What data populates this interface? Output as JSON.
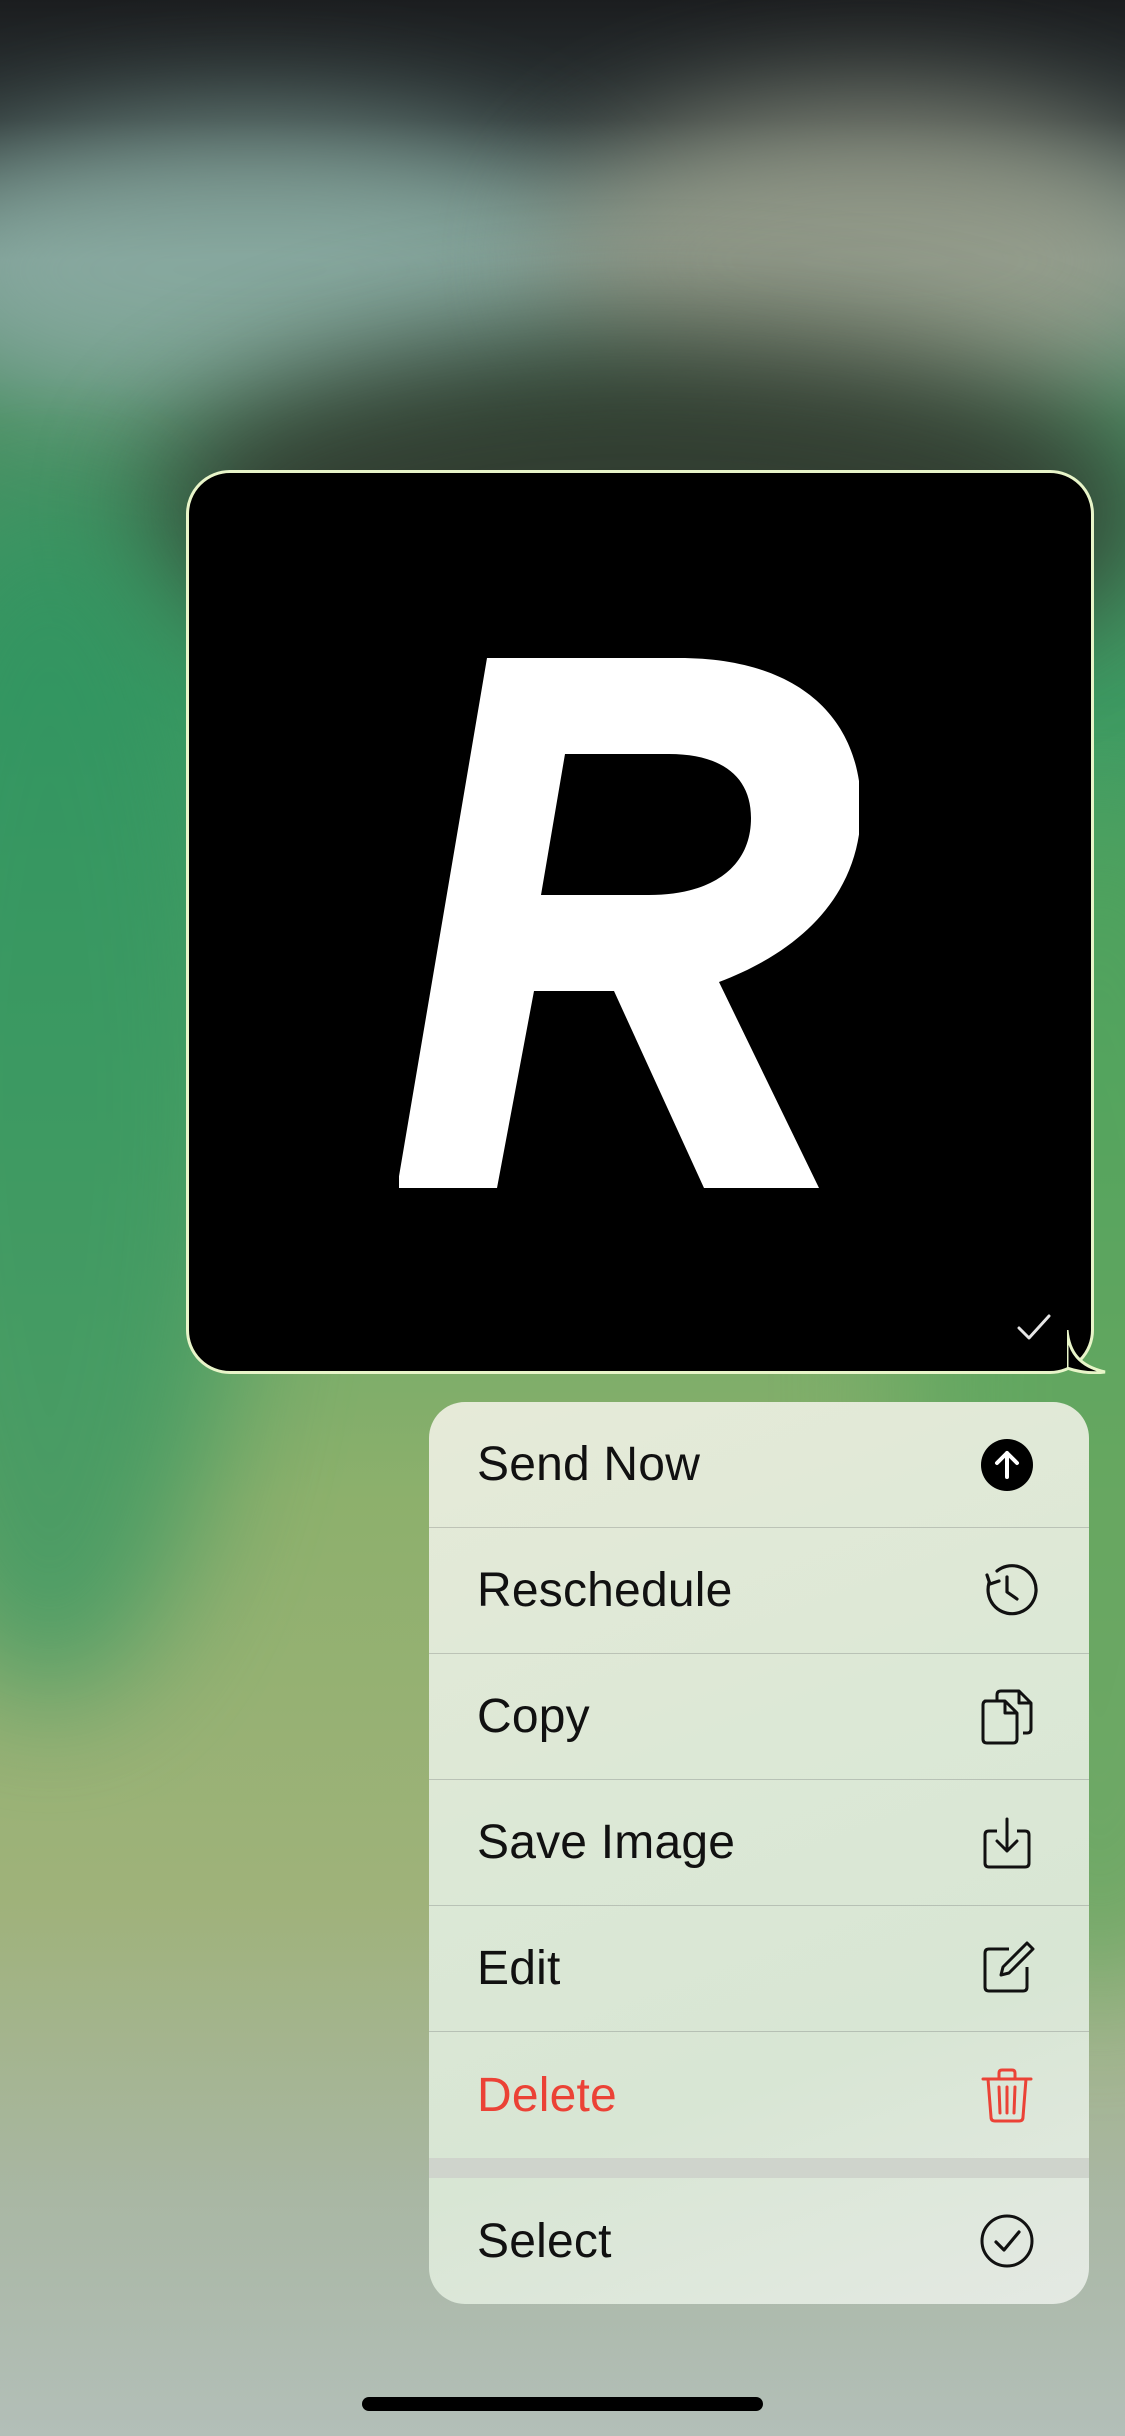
{
  "message": {
    "status_icon": "checkmark-icon",
    "image": "letter-R-logo",
    "image_background": "#000000",
    "bubble_border_color": "#e8f5c9"
  },
  "menu": {
    "items": [
      {
        "label": "Send Now",
        "icon": "arrow-up-circle-fill-icon",
        "destructive": false
      },
      {
        "label": "Reschedule",
        "icon": "clock-arrow-icon",
        "destructive": false
      },
      {
        "label": "Copy",
        "icon": "copy-documents-icon",
        "destructive": false
      },
      {
        "label": "Save Image",
        "icon": "tray-download-icon",
        "destructive": false
      },
      {
        "label": "Edit",
        "icon": "square-pencil-icon",
        "destructive": false
      },
      {
        "label": "Delete",
        "icon": "trash-icon",
        "destructive": true
      }
    ],
    "secondary_items": [
      {
        "label": "Select",
        "icon": "checkmark-circle-icon",
        "destructive": false
      }
    ],
    "destructive_color": "#eb4236"
  }
}
